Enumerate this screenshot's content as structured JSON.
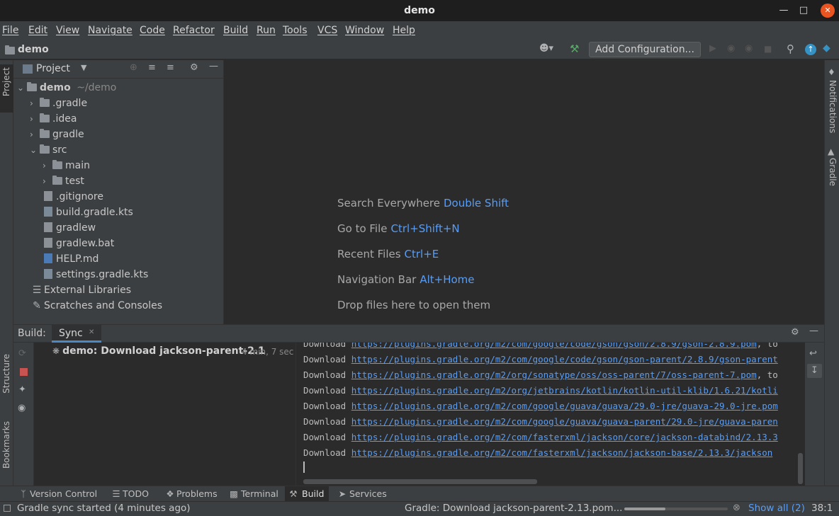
{
  "window": {
    "title": "demo"
  },
  "menu": [
    "File",
    "Edit",
    "View",
    "Navigate",
    "Code",
    "Refactor",
    "Build",
    "Run",
    "Tools",
    "VCS",
    "Window",
    "Help"
  ],
  "navbar": {
    "project": "demo",
    "add_configuration": "Add Configuration..."
  },
  "left_strip": {
    "project": "Project",
    "structure": "Structure",
    "bookmarks": "Bookmarks"
  },
  "right_strip": {
    "notifications": "Notifications",
    "gradle": "Gradle"
  },
  "project_panel": {
    "title": "Project",
    "tree": [
      {
        "label": "demo",
        "hint": "~/demo"
      },
      {
        "label": ".gradle"
      },
      {
        "label": ".idea"
      },
      {
        "label": "gradle"
      },
      {
        "label": "src"
      },
      {
        "label": "main"
      },
      {
        "label": "test"
      },
      {
        "label": ".gitignore"
      },
      {
        "label": "build.gradle.kts"
      },
      {
        "label": "gradlew"
      },
      {
        "label": "gradlew.bat"
      },
      {
        "label": "HELP.md"
      },
      {
        "label": "settings.gradle.kts"
      },
      {
        "label": "External Libraries"
      },
      {
        "label": "Scratches and Consoles"
      }
    ]
  },
  "editor_hints": [
    {
      "label": "Search Everywhere",
      "key": "Double Shift"
    },
    {
      "label": "Go to File",
      "key": "Ctrl+Shift+N"
    },
    {
      "label": "Recent Files",
      "key": "Ctrl+E"
    },
    {
      "label": "Navigation Bar",
      "key": "Alt+Home"
    },
    {
      "label": "Drop files here to open them",
      "key": ""
    }
  ],
  "build": {
    "label": "Build:",
    "tab": "Sync",
    "task": "demo: Download jackson-parent-2.1",
    "duration": "4 min, 7 sec",
    "log": [
      {
        "prefix": "Download ",
        "url": "https://plugins.gradle.org/m2/com/google/code/gson/gson/2.8.9/gson-2.8.9.pom",
        "suffix": ", to"
      },
      {
        "prefix": "Download ",
        "url": "https://plugins.gradle.org/m2/com/google/code/gson/gson-parent/2.8.9/gson-parent",
        "suffix": ""
      },
      {
        "prefix": "Download ",
        "url": "https://plugins.gradle.org/m2/org/sonatype/oss/oss-parent/7/oss-parent-7.pom",
        "suffix": ", to"
      },
      {
        "prefix": "Download ",
        "url": "https://plugins.gradle.org/m2/org/jetbrains/kotlin/kotlin-util-klib/1.6.21/kotli",
        "suffix": ""
      },
      {
        "prefix": "Download ",
        "url": "https://plugins.gradle.org/m2/com/google/guava/guava/29.0-jre/guava-29.0-jre.pom",
        "suffix": ""
      },
      {
        "prefix": "Download ",
        "url": "https://plugins.gradle.org/m2/com/google/guava/guava-parent/29.0-jre/guava-paren",
        "suffix": ""
      },
      {
        "prefix": "Download ",
        "url": "https://plugins.gradle.org/m2/com/fasterxml/jackson/core/jackson-databind/2.13.3",
        "suffix": ""
      },
      {
        "prefix": "Download ",
        "url": "https://plugins.gradle.org/m2/com/fasterxml/jackson/jackson-base/2.13.3/jackson",
        "suffix": ""
      }
    ]
  },
  "bottom_tabs": [
    "Version Control",
    "TODO",
    "Problems",
    "Terminal",
    "Build",
    "Services"
  ],
  "status": {
    "left": "Gradle sync started (4 minutes ago)",
    "progress": "Gradle: Download jackson-parent-2.13.pom...",
    "progress_fraction": 0.4,
    "show_all": "Show all (2)",
    "position": "38:1"
  },
  "colors": {
    "accent": "#589df6",
    "close_button": "#e95420",
    "background": "#2b2b2b",
    "panel": "#3c3f41"
  }
}
